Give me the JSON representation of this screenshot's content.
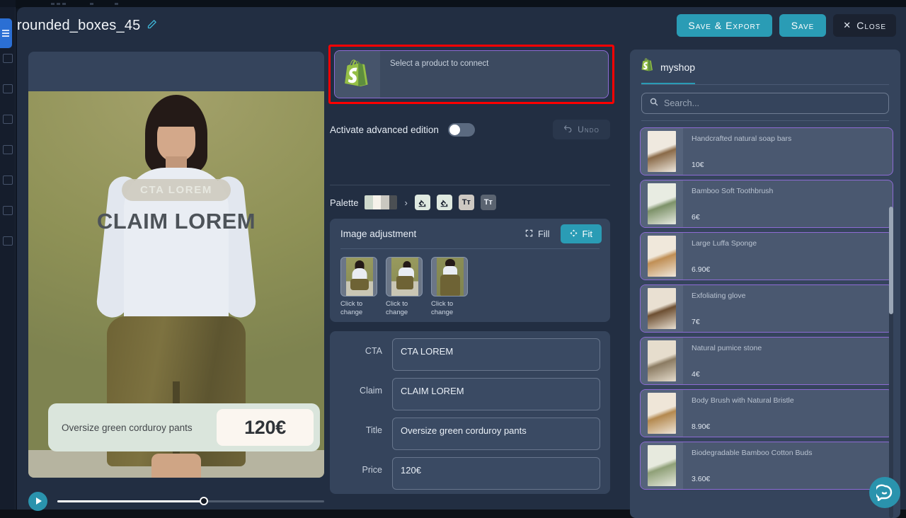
{
  "header": {
    "doc_title": "rounded_boxes_45",
    "edit_icon": "pencil-icon",
    "save_export_label": "Save & Export",
    "save_label": "Save",
    "close_label": "Close",
    "close_icon": "close-x-icon",
    "accent_color": "#2a9cb5"
  },
  "preview": {
    "cta_overlay": "CTA LOREM",
    "claim_overlay": "CLAIM LOREM",
    "info_title": "Oversize green corduroy pants",
    "info_price": "120€",
    "play_icon": "play-icon",
    "progress_percent": 55
  },
  "editor": {
    "connect": {
      "label": "Select a product to connect",
      "logo_icon": "shopify-logo-icon",
      "highlight_color": "#ff0000",
      "border_color": "#8d6bd4"
    },
    "advanced": {
      "label": "Activate advanced edition",
      "enabled": false,
      "undo_label": "Undo",
      "undo_icon": "undo-arrow-icon"
    },
    "palette": {
      "label": "Palette",
      "swatches": [
        "#cfd9cd",
        "#f6f2ea",
        "#c9c7c0",
        "#4b4f53"
      ],
      "chevron": "›",
      "tools": [
        {
          "name": "fill-color-tool-1",
          "icon": "paint-bucket-icon",
          "active": true
        },
        {
          "name": "fill-color-tool-2",
          "icon": "paint-bucket-icon",
          "active": true
        },
        {
          "name": "text-color-tool-1",
          "icon": "text-format-icon",
          "label": "Tᴛ",
          "active": true
        },
        {
          "name": "text-color-tool-2",
          "icon": "text-format-icon",
          "label": "Tᴛ",
          "active": false
        }
      ]
    },
    "image_adjustment": {
      "title": "Image adjustment",
      "fill_label": "Fill",
      "fill_icon": "expand-corners-icon",
      "fit_label": "Fit",
      "fit_icon": "move-arrows-icon",
      "selected_mode": "Fit",
      "thumbnails": [
        {
          "caption": "Click to change"
        },
        {
          "caption": "Click to change"
        },
        {
          "caption": "Click to change"
        }
      ]
    },
    "fields": [
      {
        "label": "CTA",
        "value": "CTA LOREM"
      },
      {
        "label": "Claim",
        "value": "CLAIM LOREM"
      },
      {
        "label": "Title",
        "value": "Oversize green corduroy pants"
      },
      {
        "label": "Price",
        "value": "120€"
      }
    ]
  },
  "shop_panel": {
    "shop_name": "myshop",
    "shop_icon": "shopify-logo-icon",
    "search_placeholder": "Search...",
    "search_value": "",
    "search_icon": "search-icon",
    "products": [
      {
        "name": "Handcrafted natural soap bars",
        "price": "10€"
      },
      {
        "name": "Bamboo Soft Toothbrush",
        "price": "6€"
      },
      {
        "name": "Large Luffa Sponge",
        "price": "6.90€"
      },
      {
        "name": "Exfoliating glove",
        "price": "7€"
      },
      {
        "name": "Natural pumice stone",
        "price": "4€"
      },
      {
        "name": "Body Brush with Natural Bristle",
        "price": "8.90€"
      },
      {
        "name": "Biodegradable Bamboo Cotton Buds",
        "price": "3.60€"
      }
    ]
  },
  "chat": {
    "icon": "chat-bubble-icon"
  }
}
